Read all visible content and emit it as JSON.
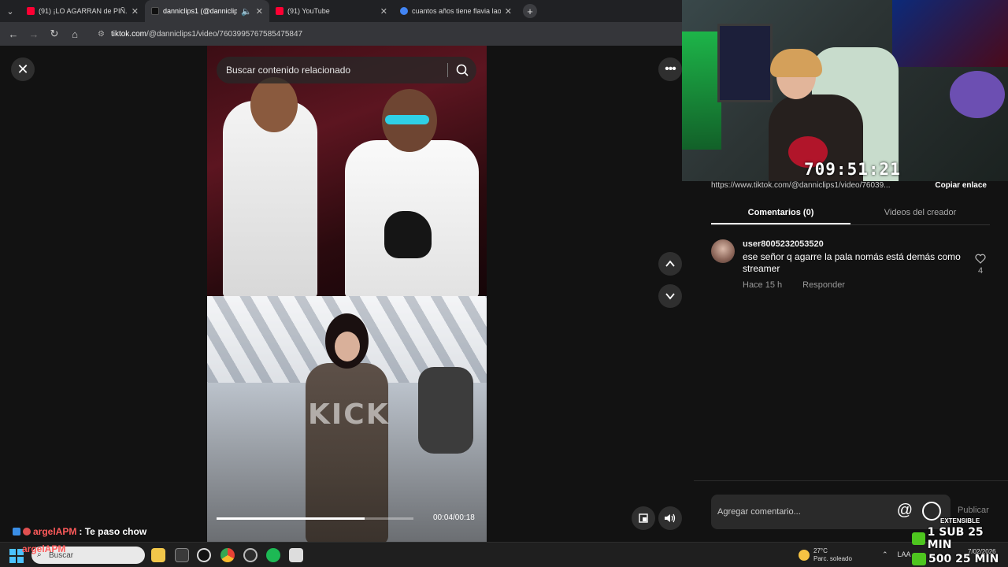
{
  "browser": {
    "tabs": [
      {
        "label": "(91) ¡LO AGARRAN de PIÑ...",
        "favicon_color": "#ff0033"
      },
      {
        "label": "danniclips1 (@danniclips1) | ...",
        "favicon_color": "#111111",
        "active": true
      },
      {
        "label": "(91) YouTube",
        "favicon_color": "#ff0033"
      },
      {
        "label": "cuantos años tiene flavia laos - ...",
        "favicon_color": "#4285f4"
      }
    ],
    "url_host": "tiktok.com",
    "url_path": "/@danniclips1/video/7603995767585475847"
  },
  "video": {
    "search_placeholder": "Buscar contenido relacionado",
    "watermark": "KICK",
    "progress": 0.75,
    "time": "00:04/00:18"
  },
  "panel": {
    "share_link": "https://www.tiktok.com/@danniclips1/video/76039...",
    "copy_label": "Copiar enlace",
    "tabs": [
      "Comentarios (0)",
      "Videos del creador"
    ],
    "comment": {
      "user": "user8005232053520",
      "text": "ese señor q agarre la pala nomás está demás como streamer",
      "time": "Hace 15 h",
      "reply": "Responder",
      "likes": "4"
    },
    "input_placeholder": "Agregar comentario...",
    "publish": "Publicar"
  },
  "stream": {
    "timer": "709:51:21",
    "chat": [
      {
        "user": "argelAPM",
        "message": ": Te paso chow"
      },
      {
        "user": "argelAPM"
      }
    ],
    "goals": [
      "1 SUB 25 MIN",
      "500 25 MIN"
    ],
    "extension_label": "EXTENSIBLE"
  },
  "taskbar": {
    "search": "Buscar",
    "weather_temp": "27°C",
    "weather_desc": "Parc. soleado",
    "lang": "LAA",
    "date": "7/02/2026"
  }
}
